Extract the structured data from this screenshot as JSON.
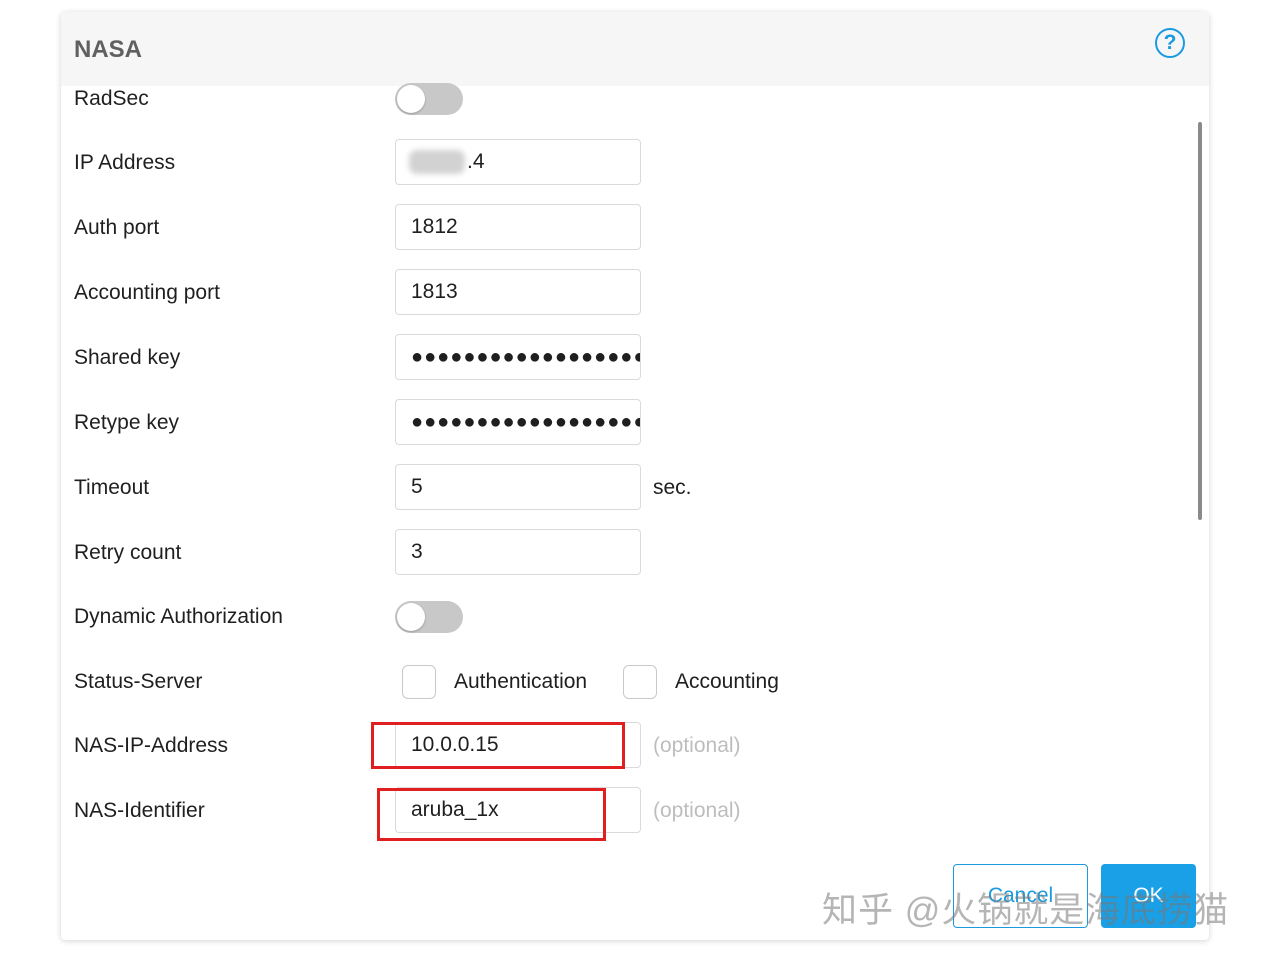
{
  "dialog": {
    "title": "NASA",
    "help_icon": "question-circle-icon"
  },
  "form": {
    "radsec": {
      "label": "RadSec",
      "enabled": false
    },
    "ip_address": {
      "label": "IP Address",
      "value": ".4"
    },
    "auth_port": {
      "label": "Auth port",
      "value": "1812"
    },
    "accounting_port": {
      "label": "Accounting port",
      "value": "1813"
    },
    "shared_key": {
      "label": "Shared key",
      "value": "●●●●●●●●●●●●●●●●●●"
    },
    "retype_key": {
      "label": "Retype key",
      "value": "●●●●●●●●●●●●●●●●●●"
    },
    "timeout": {
      "label": "Timeout",
      "value": "5",
      "unit": "sec."
    },
    "retry_count": {
      "label": "Retry count",
      "value": "3"
    },
    "dynamic_authorization": {
      "label": "Dynamic Authorization",
      "enabled": false
    },
    "status_server": {
      "label": "Status-Server",
      "authentication": {
        "label": "Authentication",
        "checked": false
      },
      "accounting": {
        "label": "Accounting",
        "checked": false
      }
    },
    "nas_ip_address": {
      "label": "NAS-IP-Address",
      "value": "10.0.0.15",
      "hint": "(optional)"
    },
    "nas_identifier": {
      "label": "NAS-Identifier",
      "value": "aruba_1x",
      "hint": "(optional)"
    }
  },
  "buttons": {
    "cancel": "Cancel",
    "ok": "OK"
  },
  "watermark": "知乎 @火锅就是海底捞猫",
  "colors": {
    "accent": "#1a9ae0",
    "highlight": "#e02020",
    "toggle_off": "#c8c8c8"
  }
}
